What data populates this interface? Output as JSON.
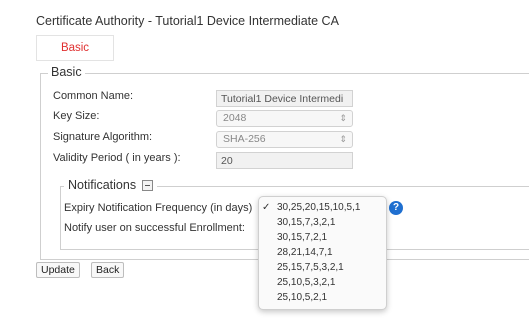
{
  "title": "Certificate Authority - Tutorial1 Device Intermediate CA",
  "tab": "Basic",
  "section": {
    "legend": "Basic",
    "fields": {
      "common_name_label": "Common Name:",
      "common_name_value": "Tutorial1 Device Intermedi",
      "key_size_label": "Key Size:",
      "key_size_value": "2048",
      "sig_alg_label": "Signature Algorithm:",
      "sig_alg_value": "SHA-256",
      "validity_label": "Validity Period ( in years ):",
      "validity_value": "20"
    }
  },
  "notifications": {
    "legend": "Notifications",
    "expiry_label": "Expiry Notification Frequency (in days)",
    "notify_label": "Notify user on successful Enrollment:",
    "options": [
      "30,25,20,15,10,5,1",
      "30,15,7,3,2,1",
      "30,15,7,2,1",
      "28,21,14,7,1",
      "25,15,7,5,3,2,1",
      "25,10,5,3,2,1",
      "25,10,5,2,1"
    ],
    "selected": "30,25,20,15,10,5,1",
    "check_glyph": "✓",
    "help_glyph": "?"
  },
  "buttons": {
    "update": "Update",
    "back": "Back"
  },
  "colors": {
    "accent": "#e03030",
    "help": "#1f6fd0"
  }
}
